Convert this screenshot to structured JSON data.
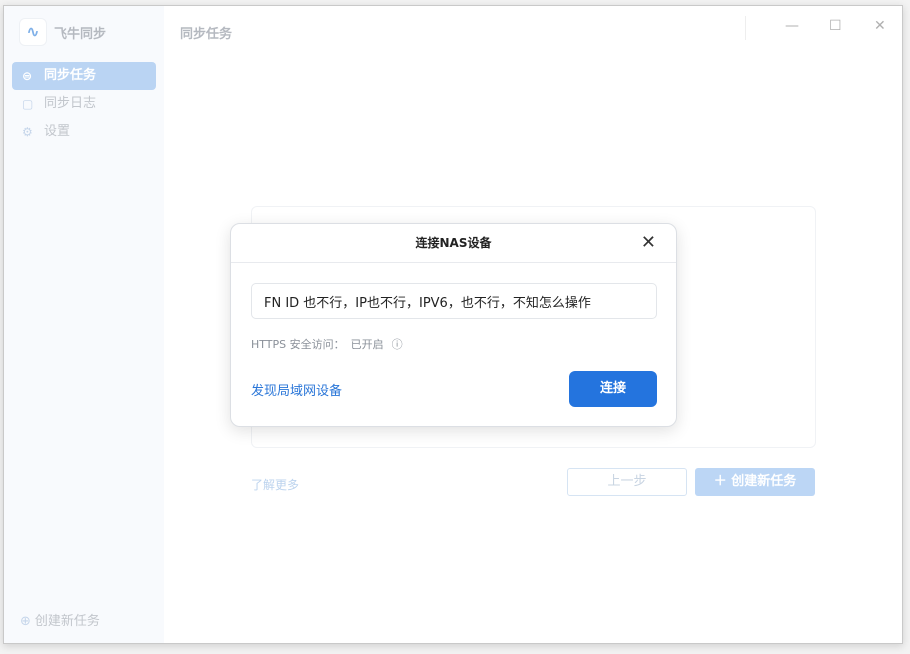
{
  "app": {
    "name": "飞牛同步",
    "page_title": "同步任务"
  },
  "sidebar": {
    "items": [
      {
        "label": "同步任务",
        "icon": "sync-icon",
        "active": true
      },
      {
        "label": "同步日志",
        "icon": "log-icon"
      },
      {
        "label": "设置",
        "icon": "gear-icon"
      }
    ],
    "create_label": "创建新任务"
  },
  "main": {
    "learn_more": "了解更多",
    "prev_label": "上一步",
    "create_label": "创建新任务"
  },
  "dialog": {
    "title": "连接NAS设备",
    "input_value": "FN ID 也不行，IP也不行，IPV6，也不行，不知怎么操作",
    "https_label": "HTTPS 安全访问：",
    "https_value": "已开启",
    "discover_label": "发现局域网设备",
    "connect_label": "连接"
  },
  "colors": {
    "accent": "#2474de",
    "sidebar_active": "#bad4f3"
  }
}
